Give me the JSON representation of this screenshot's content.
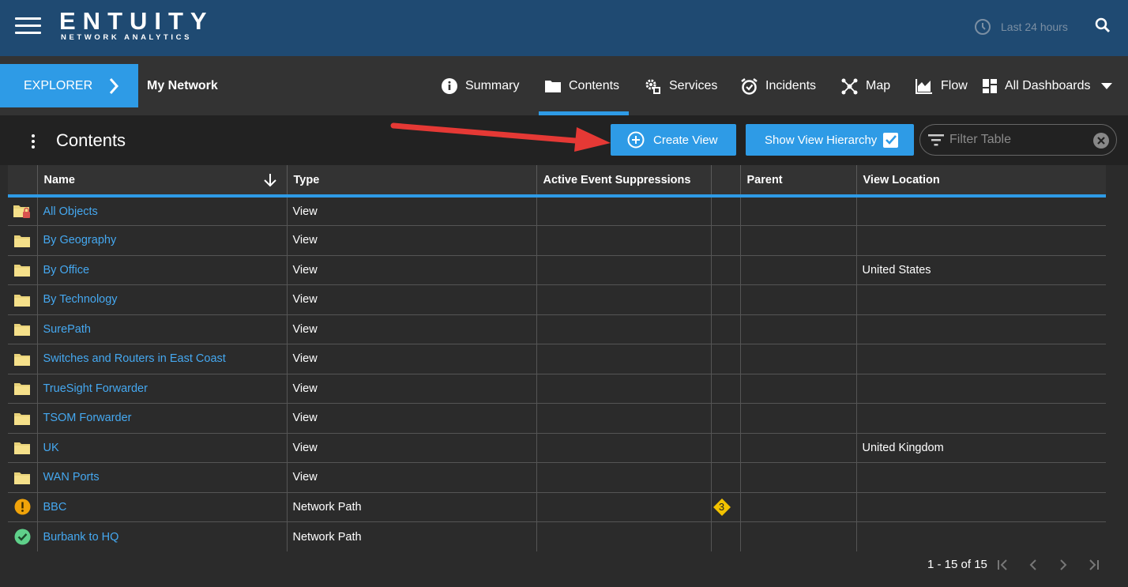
{
  "app": {
    "logo_main": "ENTUITY",
    "logo_sub": "NETWORK ANALYTICS",
    "time_range": "Last 24 hours",
    "icons": {
      "menu": "hamburger-icon",
      "clock": "clock-icon",
      "search": "search-icon"
    }
  },
  "nav": {
    "explorer_label": "EXPLORER",
    "context": "My Network",
    "items": [
      {
        "label": "Summary",
        "icon": "info-icon"
      },
      {
        "label": "Contents",
        "icon": "folder-icon",
        "active": true
      },
      {
        "label": "Services",
        "icon": "gears-icon"
      },
      {
        "label": "Incidents",
        "icon": "alarm-icon"
      },
      {
        "label": "Map",
        "icon": "network-map-icon"
      },
      {
        "label": "Flow",
        "icon": "flow-chart-icon"
      },
      {
        "label": "All Dashboards",
        "icon": "dashboard-icon",
        "dropdown": true
      }
    ],
    "accent": "#2e9be6"
  },
  "content": {
    "title": "Contents",
    "create_view_label": "Create View",
    "show_hierarchy_label": "Show View Hierarchy",
    "show_hierarchy_checked": true,
    "filter_placeholder": "Filter Table"
  },
  "table": {
    "columns": [
      "",
      "Name",
      "Type",
      "Active Event Suppressions",
      "",
      "Parent",
      "View Location"
    ],
    "sort_column": "Name",
    "rows": [
      {
        "icon": "locked-folder-icon",
        "name": "All Objects",
        "type": "View",
        "suppressions": "",
        "badge": "",
        "parent": "",
        "location": ""
      },
      {
        "icon": "folder-icon",
        "name": "By Geography",
        "type": "View",
        "suppressions": "",
        "badge": "",
        "parent": "",
        "location": ""
      },
      {
        "icon": "folder-icon",
        "name": "By Office",
        "type": "View",
        "suppressions": "",
        "badge": "",
        "parent": "",
        "location": "United States"
      },
      {
        "icon": "folder-icon",
        "name": "By Technology",
        "type": "View",
        "suppressions": "",
        "badge": "",
        "parent": "",
        "location": ""
      },
      {
        "icon": "folder-icon",
        "name": "SurePath",
        "type": "View",
        "suppressions": "",
        "badge": "",
        "parent": "",
        "location": ""
      },
      {
        "icon": "folder-icon",
        "name": "Switches and Routers in East Coast",
        "type": "View",
        "suppressions": "",
        "badge": "",
        "parent": "",
        "location": ""
      },
      {
        "icon": "folder-icon",
        "name": "TrueSight Forwarder",
        "type": "View",
        "suppressions": "",
        "badge": "",
        "parent": "",
        "location": ""
      },
      {
        "icon": "folder-icon",
        "name": "TSOM Forwarder",
        "type": "View",
        "suppressions": "",
        "badge": "",
        "parent": "",
        "location": ""
      },
      {
        "icon": "folder-icon",
        "name": "UK",
        "type": "View",
        "suppressions": "",
        "badge": "",
        "parent": "",
        "location": "United Kingdom"
      },
      {
        "icon": "folder-icon",
        "name": "WAN Ports",
        "type": "View",
        "suppressions": "",
        "badge": "",
        "parent": "",
        "location": ""
      },
      {
        "icon": "warning-status-icon",
        "name": "BBC",
        "type": "Network Path",
        "suppressions": "",
        "badge": "3",
        "parent": "",
        "location": ""
      },
      {
        "icon": "ok-status-icon",
        "name": "Burbank to HQ",
        "type": "Network Path",
        "suppressions": "",
        "badge": "",
        "parent": "",
        "location": ""
      }
    ]
  },
  "pager": {
    "range_text": "1 - 15 of 15",
    "icons": [
      "first-page-icon",
      "prev-page-icon",
      "next-page-icon",
      "last-page-icon"
    ]
  },
  "colors": {
    "topbar": "#1f4a72",
    "link": "#45a8f0",
    "folder": "#e8d27a",
    "warning": "#f0a30a",
    "ok": "#5fd08a",
    "annotation_arrow": "#e53935"
  }
}
